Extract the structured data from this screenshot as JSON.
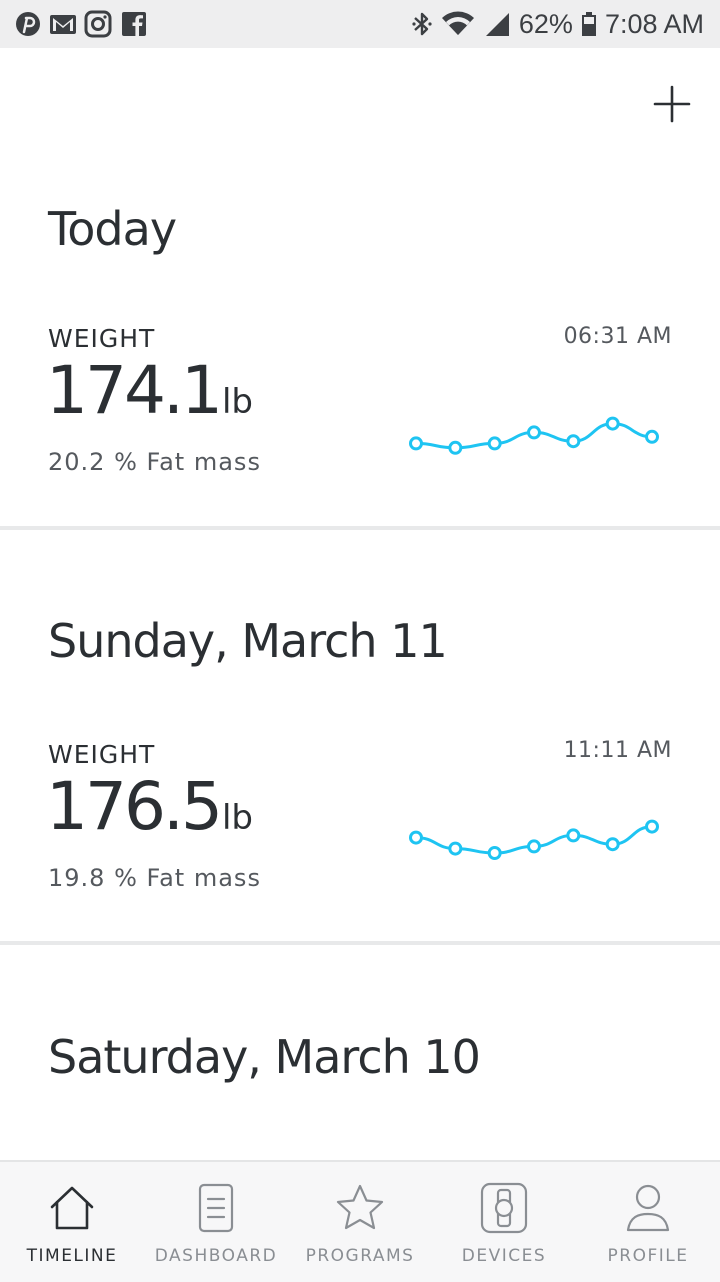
{
  "status_bar": {
    "battery": "62%",
    "time": "7:08 AM",
    "left_icons": [
      "pinterest-icon",
      "gmail-icon",
      "instagram-icon",
      "facebook-icon"
    ],
    "right_icons": [
      "bluetooth-icon",
      "wifi-icon",
      "signal-icon",
      "battery-icon"
    ]
  },
  "header": {
    "add_icon": "plus-icon"
  },
  "accent_color": "#1ec4f2",
  "sections": [
    {
      "title": "Today",
      "metric": {
        "label": "WEIGHT",
        "time": "06:31 AM",
        "value": "174.1",
        "unit": "lb",
        "sub": "20.2 % Fat mass",
        "trend": [
          3,
          1,
          3,
          8,
          4,
          12,
          6
        ]
      }
    },
    {
      "title": "Sunday, March 11",
      "metric": {
        "label": "WEIGHT",
        "time": "11:11 AM",
        "value": "176.5",
        "unit": "lb",
        "sub": "19.8 % Fat mass",
        "trend": [
          12,
          7,
          5,
          8,
          13,
          9,
          17
        ]
      }
    },
    {
      "title": "Saturday, March 10"
    }
  ],
  "nav": {
    "items": [
      {
        "label": "TIMELINE",
        "icon": "home-icon",
        "active": true
      },
      {
        "label": "DASHBOARD",
        "icon": "document-icon",
        "active": false
      },
      {
        "label": "PROGRAMS",
        "icon": "star-icon",
        "active": false
      },
      {
        "label": "DEVICES",
        "icon": "watch-icon",
        "active": false
      },
      {
        "label": "PROFILE",
        "icon": "person-icon",
        "active": false
      }
    ]
  }
}
